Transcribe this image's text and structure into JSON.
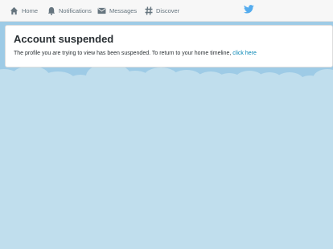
{
  "nav": {
    "items": [
      {
        "label": "Home",
        "icon": "home-icon"
      },
      {
        "label": "Notifications",
        "icon": "bell-icon"
      },
      {
        "label": "Messages",
        "icon": "envelope-icon"
      },
      {
        "label": "Discover",
        "icon": "hashtag-icon"
      }
    ],
    "logo_icon": "twitter-bird-icon"
  },
  "card": {
    "title": "Account suspended",
    "message": "The profile you are trying to view has been suspended. To return to your home timeline,",
    "link": "click here"
  },
  "colors": {
    "accent": "#55acee",
    "link": "#0084b4",
    "sky": "#c0deed",
    "sky_dark": "#9ecbe6"
  }
}
